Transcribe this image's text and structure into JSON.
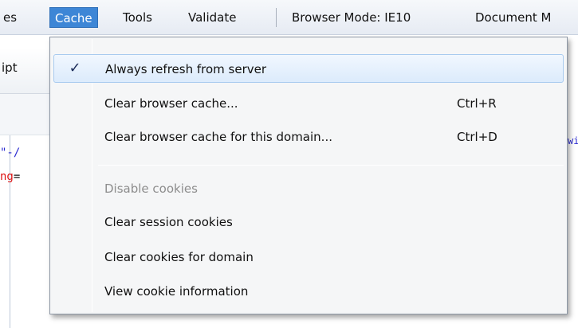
{
  "menubar": {
    "items": [
      "es",
      "Cache",
      "Tools",
      "Validate",
      "Browser Mode: IE10",
      "Document M"
    ]
  },
  "left_panel": {
    "tab_label": "ipt",
    "code_line1": "\"-/",
    "code_line2_red": "ng",
    "code_line2_rest": "=",
    "right_fragment": "wi"
  },
  "dropdown": {
    "items": [
      {
        "label": "Always refresh from server",
        "shortcut": "",
        "checked": true
      },
      {
        "label": "Clear browser cache...",
        "shortcut": "Ctrl+R"
      },
      {
        "label": "Clear browser cache for this domain...",
        "shortcut": "Ctrl+D"
      },
      {
        "label": "Disable cookies",
        "shortcut": "",
        "disabled": true
      },
      {
        "label": "Clear session cookies",
        "shortcut": ""
      },
      {
        "label": "Clear cookies for domain",
        "shortcut": ""
      },
      {
        "label": "View cookie information",
        "shortcut": ""
      }
    ],
    "check_glyph": "✓"
  }
}
